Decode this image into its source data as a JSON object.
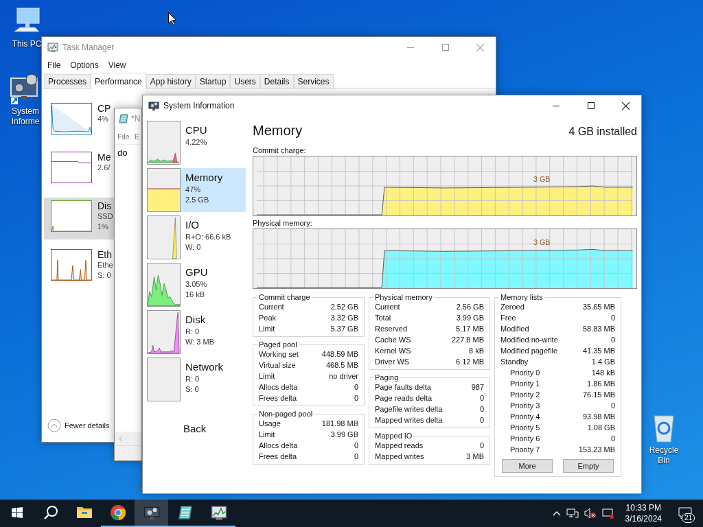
{
  "desktop": {
    "icons": [
      {
        "kind": "computer",
        "label": "This PC"
      },
      {
        "kind": "app",
        "label": "System Informe"
      },
      {
        "kind": "bin",
        "label": "Recycle Bin"
      }
    ]
  },
  "task_manager": {
    "title": "Task Manager",
    "menu": [
      "File",
      "Options",
      "View"
    ],
    "tabs": [
      {
        "label": "Processes",
        "selected": false
      },
      {
        "label": "Performance",
        "selected": true
      },
      {
        "label": "App history",
        "selected": false
      },
      {
        "label": "Startup",
        "selected": false
      },
      {
        "label": "Users",
        "selected": false
      },
      {
        "label": "Details",
        "selected": false
      },
      {
        "label": "Services",
        "selected": false
      }
    ],
    "resources": [
      {
        "name": "CP",
        "lines": [
          "4%"
        ],
        "color": "#1c7fc4",
        "selected": false
      },
      {
        "name": "Me",
        "lines": [
          "2.6/"
        ],
        "color": "#8b2f9b",
        "selected": false
      },
      {
        "name": "Dis",
        "lines": [
          "SSD",
          "1%"
        ],
        "color": "#5ca01e",
        "selected": true
      },
      {
        "name": "Eth",
        "lines": [
          "Ethe",
          "S: 0"
        ],
        "color": "#a74f01",
        "selected": false
      }
    ],
    "fewer_details": "Fewer details"
  },
  "notepad": {
    "title": "*N",
    "menu": [
      "File",
      "E"
    ],
    "text": "do"
  },
  "system_information": {
    "title": "System Information",
    "nav": [
      {
        "name": "CPU",
        "lines": [
          "4.22%"
        ],
        "selected": false
      },
      {
        "name": "Memory",
        "lines": [
          "47%",
          "2.5 GB"
        ],
        "selected": true
      },
      {
        "name": "I/O",
        "lines": [
          "R+O: 66.6 kB",
          "W: 0"
        ],
        "selected": false
      },
      {
        "name": "GPU",
        "lines": [
          "3.05%",
          "16 kB"
        ],
        "selected": false
      },
      {
        "name": "Disk",
        "lines": [
          "R: 0",
          "W: 3 MB"
        ],
        "selected": false
      },
      {
        "name": "Network",
        "lines": [
          "R: 0",
          "S: 0"
        ],
        "selected": false
      }
    ],
    "back": "Back",
    "heading": "Memory",
    "installed": "4 GB installed",
    "graphs": [
      {
        "label": "Commit charge:",
        "marker": "3 GB",
        "color": "#fff080"
      },
      {
        "label": "Physical memory:",
        "marker": "3 GB",
        "color": "#80f8ff"
      }
    ],
    "columns": [
      [
        {
          "title": "Commit charge",
          "rows": [
            {
              "label": "Current",
              "value": "2.52 GB"
            },
            {
              "label": "Peak",
              "value": "3.32 GB"
            },
            {
              "label": "Limit",
              "value": "5.37 GB"
            }
          ]
        },
        {
          "title": "Paged pool",
          "rows": [
            {
              "label": "Working set",
              "value": "448.59 MB"
            },
            {
              "label": "Virtual size",
              "value": "468.5 MB"
            },
            {
              "label": "Limit",
              "value": "no driver"
            },
            {
              "label": "Allocs delta",
              "value": "0"
            },
            {
              "label": "Frees delta",
              "value": "0"
            }
          ]
        },
        {
          "title": "Non-paged pool",
          "rows": [
            {
              "label": "Usage",
              "value": "181.98 MB"
            },
            {
              "label": "Limit",
              "value": "3.99 GB"
            },
            {
              "label": "Allocs delta",
              "value": "0"
            },
            {
              "label": "Frees delta",
              "value": "0"
            }
          ]
        }
      ],
      [
        {
          "title": "Physical memory",
          "rows": [
            {
              "label": "Current",
              "value": "2.56 GB"
            },
            {
              "label": "Total",
              "value": "3.99 GB"
            },
            {
              "label": "Reserved",
              "value": "5.17 MB"
            },
            {
              "label": "Cache WS",
              "value": "227.8 MB"
            },
            {
              "label": "Kernel WS",
              "value": "8 kB"
            },
            {
              "label": "Driver WS",
              "value": "6.12 MB"
            }
          ]
        },
        {
          "title": "Paging",
          "rows": [
            {
              "label": "Page faults delta",
              "value": "987"
            },
            {
              "label": "Page reads delta",
              "value": "0"
            },
            {
              "label": "Pagefile writes delta",
              "value": "0"
            },
            {
              "label": "Mapped writes delta",
              "value": "0"
            }
          ]
        },
        {
          "title": "Mapped IO",
          "rows": [
            {
              "label": "Mapped reads",
              "value": "0"
            },
            {
              "label": "Mapped writes",
              "value": "3 MB"
            }
          ]
        }
      ],
      [
        {
          "title": "Memory lists",
          "rows": [
            {
              "label": "Zeroed",
              "value": "35.65 MB"
            },
            {
              "label": "Free",
              "value": "0"
            },
            {
              "label": "Modified",
              "value": "58.83 MB"
            },
            {
              "label": "Modified no-write",
              "value": "0"
            },
            {
              "label": "Modified pagefile",
              "value": "41.35 MB"
            },
            {
              "label": "Standby",
              "value": "1.4 GB",
              "children": [
                {
                  "label": "Priority 0",
                  "value": "148 kB"
                },
                {
                  "label": "Priority 1",
                  "value": "1.86 MB"
                },
                {
                  "label": "Priority 2",
                  "value": "76.15 MB"
                },
                {
                  "label": "Priority 3",
                  "value": "0"
                },
                {
                  "label": "Priority 4",
                  "value": "93.98 MB"
                },
                {
                  "label": "Priority 5",
                  "value": "1.08 GB"
                },
                {
                  "label": "Priority 6",
                  "value": "0"
                },
                {
                  "label": "Priority 7",
                  "value": "153.23 MB"
                }
              ]
            }
          ],
          "buttons": [
            "More",
            "Empty"
          ]
        }
      ]
    ]
  },
  "taskbar": {
    "apps": [
      {
        "kind": "start",
        "running": false,
        "selected": false
      },
      {
        "kind": "search",
        "running": false,
        "selected": false
      },
      {
        "kind": "folder",
        "running": false,
        "selected": false
      },
      {
        "kind": "browser",
        "running": true,
        "selected": false
      },
      {
        "kind": "monitor",
        "running": true,
        "selected": true
      },
      {
        "kind": "notepad",
        "running": true,
        "selected": false
      },
      {
        "kind": "chart",
        "running": true,
        "selected": false
      }
    ],
    "time": "10:33 PM",
    "date": "3/16/2024",
    "notifications": "21"
  }
}
